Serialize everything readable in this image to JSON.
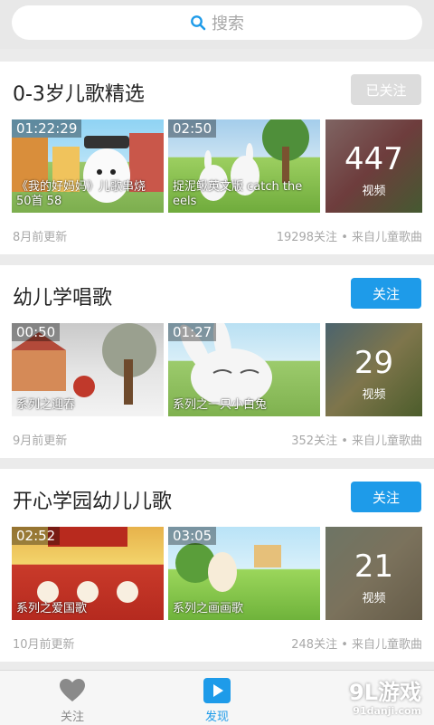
{
  "search": {
    "placeholder": "搜索"
  },
  "cards": [
    {
      "title": "0-3岁儿歌精选",
      "follow_label": "已关注",
      "followed": true,
      "videos": [
        {
          "duration": "01:22:29",
          "caption": "《我的好妈妈》儿歌串烧50首 58"
        },
        {
          "duration": "02:50",
          "caption": "捉泥鳅英文版 catch the eels"
        }
      ],
      "more": {
        "count": "447",
        "label": "视频"
      },
      "updated": "8月前更新",
      "stats": "19298关注 • 来自儿童歌曲"
    },
    {
      "title": "幼儿学唱歌",
      "follow_label": "关注",
      "followed": false,
      "videos": [
        {
          "duration": "00:50",
          "caption": "系列之迎春"
        },
        {
          "duration": "01:27",
          "caption": "系列之一只小白兔"
        }
      ],
      "more": {
        "count": "29",
        "label": "视频"
      },
      "updated": "9月前更新",
      "stats": "352关注 • 来自儿童歌曲"
    },
    {
      "title": "开心学园幼儿儿歌",
      "follow_label": "关注",
      "followed": false,
      "videos": [
        {
          "duration": "02:52",
          "caption": "系列之爱国歌"
        },
        {
          "duration": "03:05",
          "caption": "系列之画画歌"
        }
      ],
      "more": {
        "count": "21",
        "label": "视频"
      },
      "updated": "10月前更新",
      "stats": "248关注 • 来自儿童歌曲"
    }
  ],
  "tabs": [
    {
      "label": "关注",
      "icon": "heart-icon",
      "active": false
    },
    {
      "label": "发现",
      "icon": "play-icon",
      "active": true
    }
  ],
  "watermark": {
    "logo": "9L游戏",
    "site": "91danji.com"
  },
  "colors": {
    "accent": "#1e9be9",
    "muted": "#a8a8a8"
  }
}
